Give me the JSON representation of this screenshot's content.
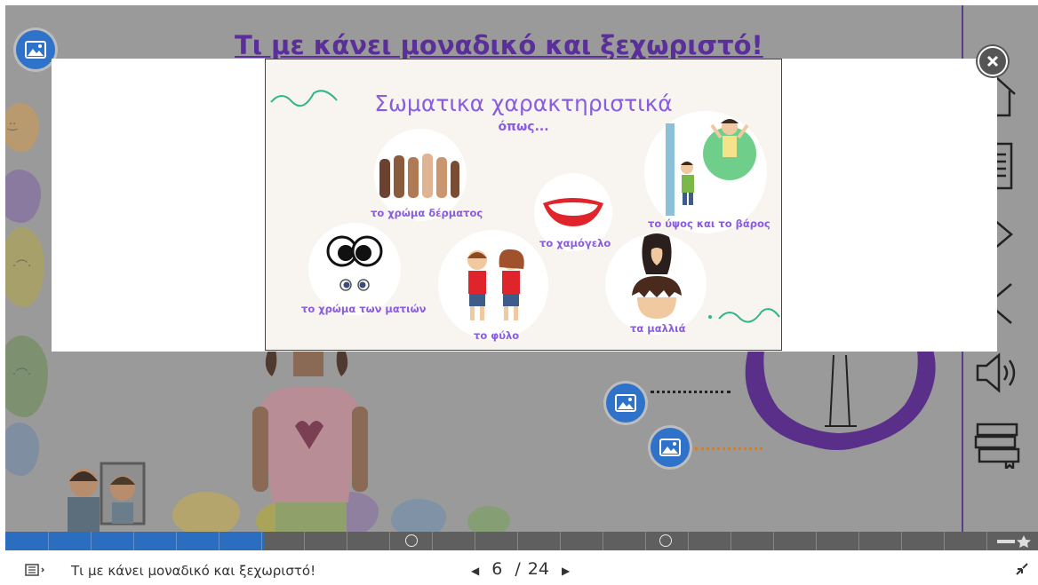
{
  "slide": {
    "title": "Τι με κάνει μοναδικό και ξεχωριστό!"
  },
  "modal": {
    "card": {
      "title": "Σωματικα χαρακτηριστικά",
      "subtitle": "όπως...",
      "items": [
        {
          "label": "το χρώμα δέρματος",
          "icon": "raised-hands-icon"
        },
        {
          "label": "το χαμόγελο",
          "icon": "smile-lips-icon"
        },
        {
          "label": "το ύψος και το βάρος",
          "icon": "height-measure-icon"
        },
        {
          "label": "το χρώμα των ματιών",
          "icon": "eyes-icon"
        },
        {
          "label": "το φύλο",
          "icon": "boy-girl-icon"
        },
        {
          "label": "τα μαλλιά",
          "icon": "hair-icon"
        }
      ],
      "accent": "#8a5de0",
      "squiggle_color": "#2fb58a"
    },
    "close_icon": "close-icon"
  },
  "right_panel": {
    "icons": [
      "home-icon",
      "document-icon",
      "next-icon",
      "previous-icon",
      "speaker-icon",
      "library-icon"
    ]
  },
  "progress": {
    "fraction": 0.25,
    "fill_color": "#2b6ec0"
  },
  "footer": {
    "menu_icon": "menu-icon",
    "title": "Τι με κάνει μοναδικό και ξεχωριστό!",
    "page_current": "6",
    "page_separator": "/",
    "page_total": "24",
    "prev_icon": "prev-page-icon",
    "next_icon": "next-page-icon",
    "fullscreen_icon": "exit-fullscreen-icon"
  },
  "colors": {
    "title": "#5a2f9a",
    "button_blue": "#2f72c9"
  }
}
